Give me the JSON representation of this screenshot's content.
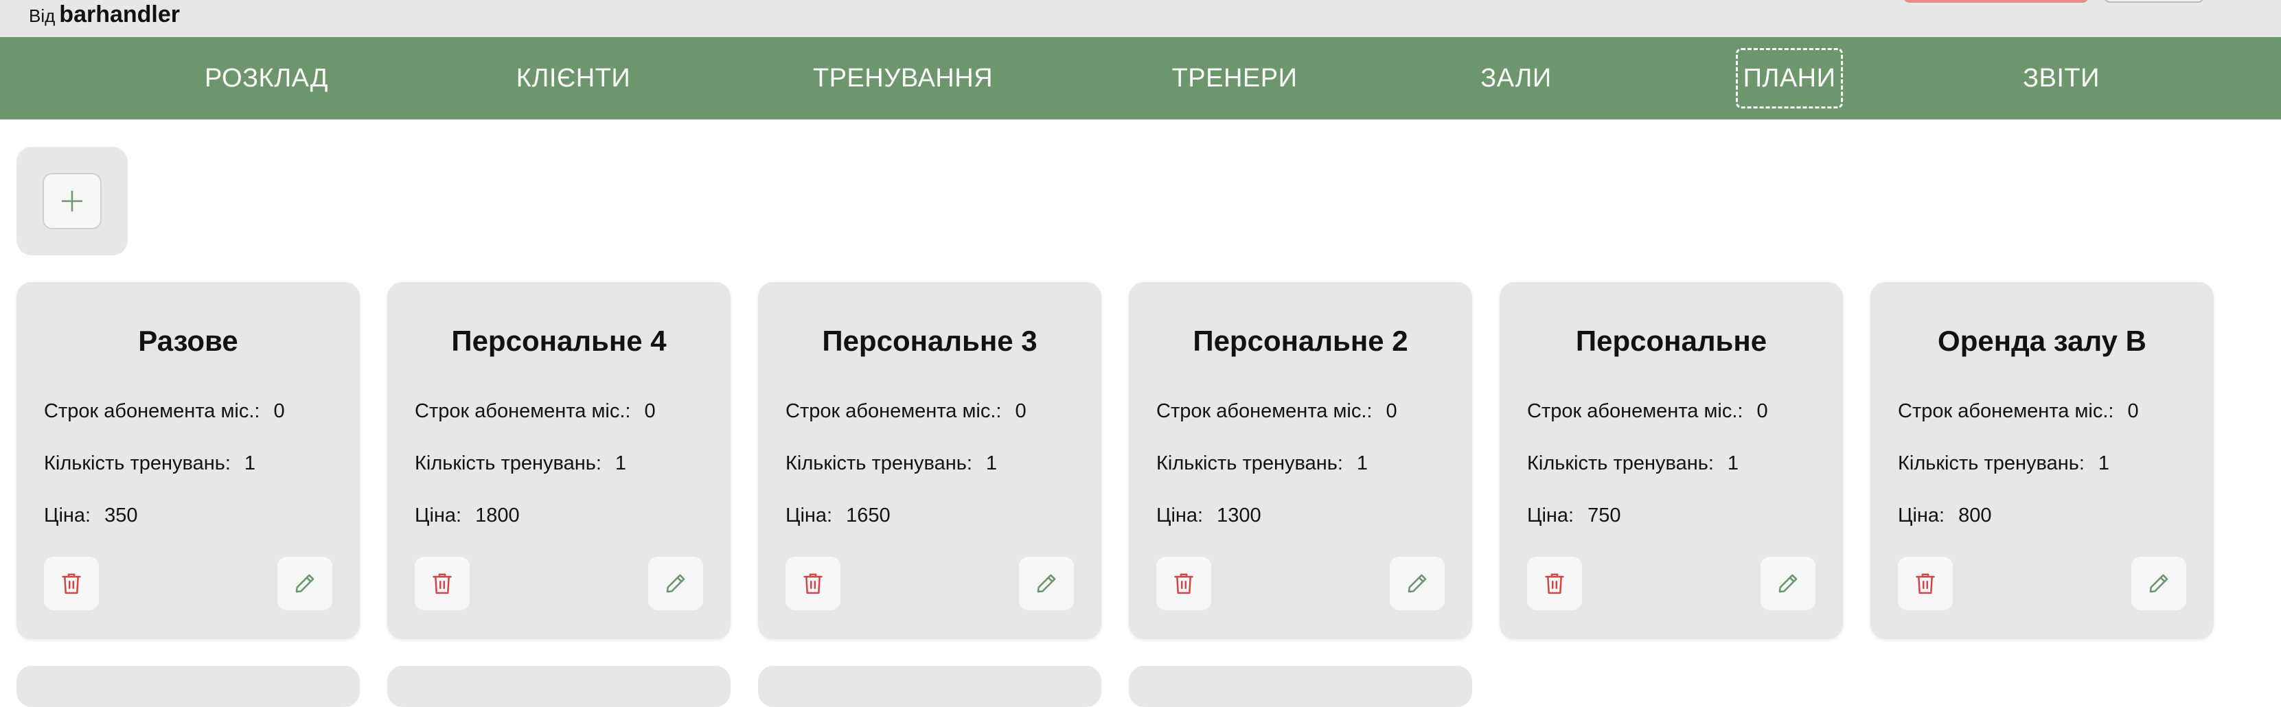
{
  "header": {
    "by_prefix": "Від",
    "username": "barhandler"
  },
  "nav": {
    "items": [
      {
        "label": "РОЗКЛАД"
      },
      {
        "label": "КЛІЄНТИ"
      },
      {
        "label": "ТРЕНУВАННЯ"
      },
      {
        "label": "ТРЕНЕРИ"
      },
      {
        "label": "ЗАЛИ"
      },
      {
        "label": "ПЛАНИ",
        "active": true
      },
      {
        "label": "ЗВІТИ"
      }
    ]
  },
  "colors": {
    "navbar": "#6d966d",
    "accent_green": "#6d966d",
    "delete_red": "#d04545",
    "card_bg": "#e6e7e9"
  },
  "labels": {
    "term": "Строк абонемента міс.:",
    "count": "Кількість тренувань:",
    "price": "Ціна:"
  },
  "icons": {
    "add": "plus-icon",
    "delete": "trash-icon",
    "edit": "pencil-icon"
  },
  "plans": [
    {
      "name": "Разове",
      "term": "0",
      "count": "1",
      "price": "350"
    },
    {
      "name": "Персональне 4",
      "term": "0",
      "count": "1",
      "price": "1800"
    },
    {
      "name": "Персональне 3",
      "term": "0",
      "count": "1",
      "price": "1650"
    },
    {
      "name": "Персональне 2",
      "term": "0",
      "count": "1",
      "price": "1300"
    },
    {
      "name": "Персональне",
      "term": "0",
      "count": "1",
      "price": "750"
    },
    {
      "name": "Оренда залу В",
      "term": "0",
      "count": "1",
      "price": "800"
    }
  ]
}
